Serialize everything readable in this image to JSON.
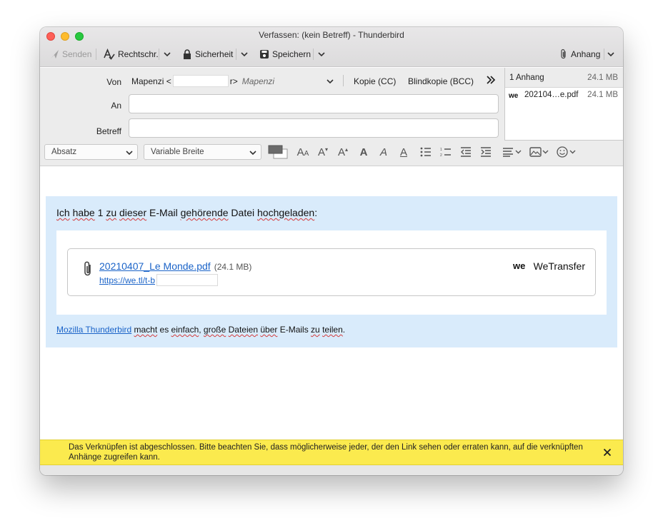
{
  "window": {
    "title": "Verfassen: (kein Betreff) - Thunderbird"
  },
  "toolbar": {
    "send_label": "Senden",
    "spelling_label": "Rechtschr.",
    "security_label": "Sicherheit",
    "save_label": "Speichern",
    "attach_label": "Anhang"
  },
  "header": {
    "from_label": "Von",
    "from_name_prefix": "Mapenzi <",
    "from_email_suffix": "r>",
    "from_identity": "Mapenzi",
    "cc_label": "Kopie (CC)",
    "bcc_label": "Blindkopie (BCC)",
    "to_label": "An",
    "to_value": "",
    "subject_label": "Betreff",
    "subject_value": ""
  },
  "attachments": {
    "count_label": "1 Anhang",
    "total_size": "24.1 MB",
    "items": [
      {
        "name": "202104…e.pdf",
        "size": "24.1 MB",
        "icon": "wetransfer-icon"
      }
    ]
  },
  "format": {
    "paragraph_select": "Absatz",
    "font_select": "Variable Breite"
  },
  "message": {
    "intro_parts": [
      "Ich",
      " ",
      "habe",
      " 1 ",
      "zu",
      " ",
      "dieser",
      " E-Mail ",
      "gehörende",
      " Datei ",
      "hochgeladen",
      ":"
    ],
    "file_name": "20210407_Le Monde.pdf",
    "file_size": "(24.1 MB)",
    "file_url": "https://we.tl/t-b",
    "provider_name": "WeTransfer",
    "footer_link": "Mozilla Thunderbird",
    "footer_parts": [
      " ",
      "macht",
      " es ",
      "einfach",
      ", ",
      "große",
      " ",
      "Dateien",
      " ",
      "über",
      " E-Mails ",
      "zu",
      " ",
      "teilen",
      "."
    ]
  },
  "notice": {
    "text": "Das Verknüpfen ist abgeschlossen. Bitte beachten Sie, dass möglicherweise jeder, der den Link sehen oder erraten kann, auf die verknüpften Anhänge zugreifen kann."
  },
  "colors": {
    "link": "#1a63c8",
    "notice_bg": "#fbea4e",
    "card_bg": "#d9ebfb"
  }
}
